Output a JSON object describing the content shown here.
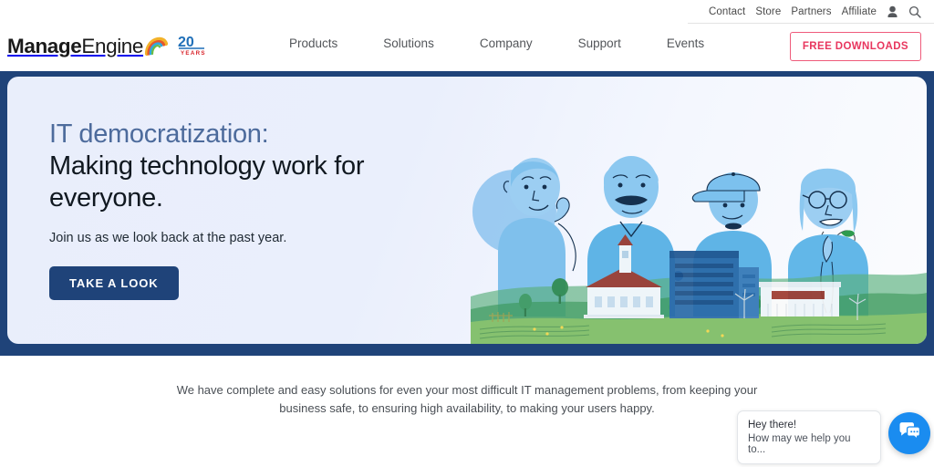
{
  "utility": {
    "links": [
      {
        "label": "Contact"
      },
      {
        "label": "Store"
      },
      {
        "label": "Partners"
      },
      {
        "label": "Affiliate"
      }
    ],
    "icons": [
      {
        "name": "user-icon"
      },
      {
        "name": "search-icon"
      }
    ]
  },
  "header": {
    "logo": {
      "text_bold": "Manage",
      "text_light": "Engine",
      "badge_number": "20",
      "badge_label": "YEARS"
    },
    "nav": [
      {
        "label": "Products"
      },
      {
        "label": "Solutions"
      },
      {
        "label": "Company"
      },
      {
        "label": "Support"
      },
      {
        "label": "Events"
      }
    ],
    "cta": {
      "label": "FREE DOWNLOADS"
    }
  },
  "hero": {
    "heading_line1": "IT democratization:",
    "heading_line2": "Making technology work for everyone.",
    "subheading": "Join us as we look back at the past year.",
    "button_label": "TAKE A LOOK",
    "decorations": [
      {
        "name": "yellow-triangle"
      },
      {
        "name": "leaf-squiggle"
      },
      {
        "name": "blue-dot"
      },
      {
        "name": "diamond-outline"
      }
    ],
    "illustration_alt": "four stylized people with green landscape and buildings"
  },
  "blurb": {
    "line1": "We have complete and easy solutions for even your most difficult IT management problems, from keeping your",
    "line2": "business safe, to ensuring high availability, to making your users happy."
  },
  "chat": {
    "greeting": "Hey there!",
    "message": "How may we help you to...",
    "fab_icon": "chat-icon"
  },
  "colors": {
    "navy": "#1f4379",
    "hero_card": "#e9eefb",
    "accent_red": "#e8365e",
    "accent_border": "#ef5b7b",
    "heading_blue": "#4d6b9c",
    "chat_blue": "#1a8cf0",
    "yellow": "#f5cf1e",
    "green": "#2e9b4f"
  }
}
